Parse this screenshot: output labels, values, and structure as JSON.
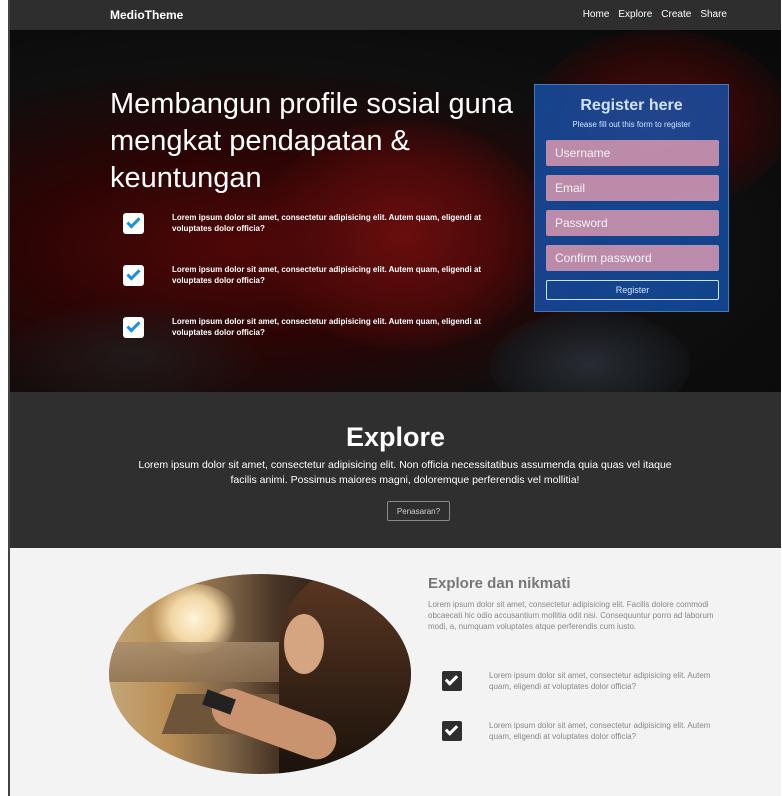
{
  "navbar": {
    "brand": "MedioTheme",
    "links": [
      "Home",
      "Explore",
      "Create",
      "Share"
    ]
  },
  "hero": {
    "title": "Membangun profile sosial guna mengkat pendapatan & keuntungan",
    "checks": [
      "Lorem ipsum dolor sit amet, consectetur adipisicing elit. Autem quam, eligendi at voluptates dolor officia?",
      "Lorem ipsum dolor sit amet, consectetur adipisicing elit. Autem quam, eligendi at voluptates dolor officia?",
      "Lorem ipsum dolor sit amet, consectetur adipisicing elit. Autem quam, eligendi at voluptates dolor officia?"
    ]
  },
  "register": {
    "title": "Register here",
    "subtitle": "Please fill out this form to register",
    "username_placeholder": "Username",
    "email_placeholder": "Email",
    "password_placeholder": "Password",
    "confirm_placeholder": "Confirm password",
    "button_label": "Register"
  },
  "explore": {
    "title": "Explore",
    "text": "Lorem ipsum dolor sit amet, consectetur adipisicing elit. Non officia necessitatibus assumenda quia quas vel itaque facilis animi. Possimus maiores magni, doloremque perferendis vel mollitia!",
    "button_label": "Penasaran?"
  },
  "feature": {
    "title": "Explore dan nikmati",
    "text": "Lorem ipsum dolor sit amet, consectetur adipisicing elit. Facilis dolore commodi obcaecati hic odio accusantium mollitia odit nisi. Consequuntur porro ad laborum modi, a, numquam voluptates atque perferendis cum iusto.",
    "checks": [
      "Lorem ipsum dolor sit amet, consectetur adipisicing elit. Autem quam, eligendi at voluptates dolor officia?",
      "Lorem ipsum dolor sit amet, consectetur adipisicing elit. Autem quam, eligendi at voluptates dolor officia?"
    ]
  },
  "colors": {
    "navbar_bg": "#2e2e2e",
    "register_accent": "#1c5fbe",
    "check_accent": "#1c8fe0",
    "explore_bg": "#2f2f2f",
    "feature_bg": "#f3f3f3"
  }
}
